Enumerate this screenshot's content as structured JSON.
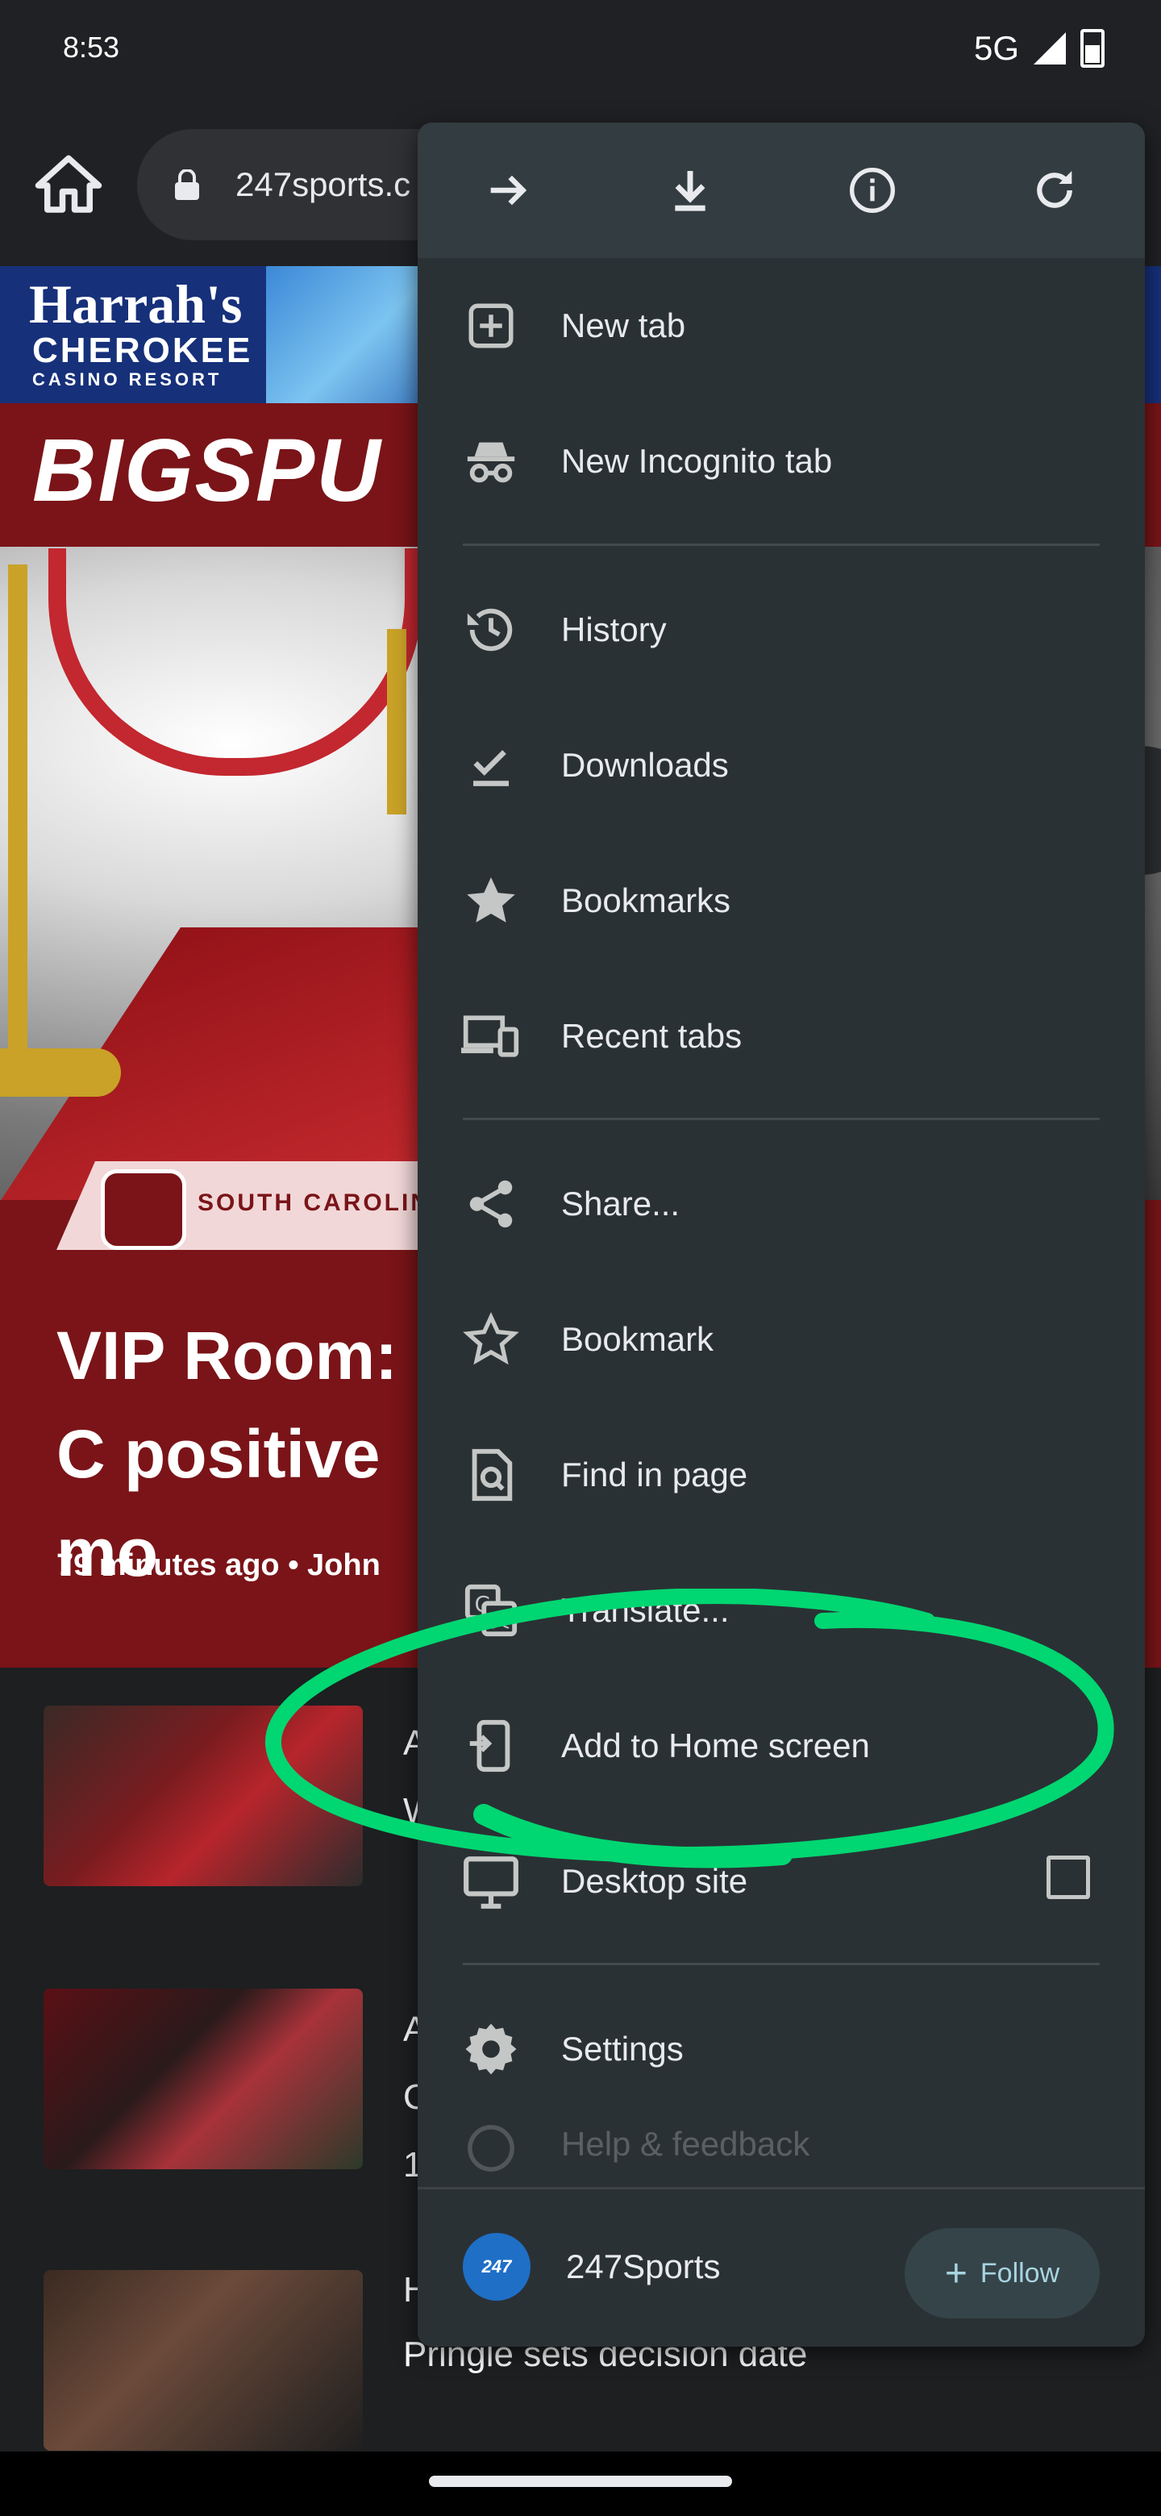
{
  "status_bar": {
    "time": "8:53",
    "network": "5G"
  },
  "toolbar": {
    "url": "247sports.c",
    "home_icon": "home-icon",
    "lock_icon": "lock-icon"
  },
  "page": {
    "ad": {
      "line1": "Harrah's",
      "line2": "CHEROKEE",
      "line3": "CASINO RESORT"
    },
    "brand": "BIGSPU",
    "tag": "SOUTH CAROLIN",
    "headline": "VIP Room: C positive mo",
    "byline": "79 minutes ago  •  John",
    "rows": [
      {
        "title": "A\nW"
      },
      {
        "title": "A\nC\n1"
      },
      {
        "title": "Pringle sets decision date",
        "prefix": "H"
      }
    ]
  },
  "menu": {
    "top_actions": [
      "forward-icon",
      "download-icon",
      "info-icon",
      "refresh-icon"
    ],
    "items": [
      {
        "label": "New tab",
        "icon": "new-tab-icon"
      },
      {
        "label": "New Incognito tab",
        "icon": "incognito-icon"
      },
      {
        "label": "History",
        "icon": "history-icon"
      },
      {
        "label": "Downloads",
        "icon": "downloads-icon"
      },
      {
        "label": "Bookmarks",
        "icon": "bookmarks-icon"
      },
      {
        "label": "Recent tabs",
        "icon": "recent-tabs-icon"
      },
      {
        "label": "Share...",
        "icon": "share-icon"
      },
      {
        "label": "Bookmark",
        "icon": "bookmark-star-icon"
      },
      {
        "label": "Find in page",
        "icon": "find-icon"
      },
      {
        "label": "Translate...",
        "icon": "translate-icon"
      },
      {
        "label": "Add to Home screen",
        "icon": "add-home-icon"
      },
      {
        "label": "Desktop site",
        "icon": "desktop-icon"
      },
      {
        "label": "Settings",
        "icon": "settings-icon"
      },
      {
        "label": "Help & feedback",
        "icon": "help-icon"
      }
    ],
    "footer": {
      "site_name": "247Sports",
      "logo_text": "247",
      "follow_label": "Follow"
    }
  },
  "colors": {
    "menu_bg": "#2a3134",
    "annotation": "#00d672",
    "brand_red": "#7a1418"
  }
}
